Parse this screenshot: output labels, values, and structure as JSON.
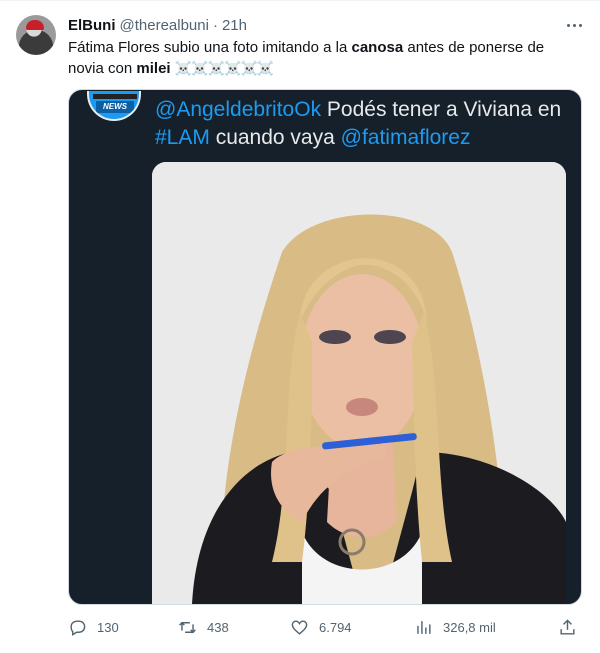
{
  "tweet": {
    "author": {
      "display_name": "ElBuni",
      "handle": "@therealbuni",
      "separator": "·",
      "time": "21h"
    },
    "text": {
      "part1": "Fátima Flores subio una foto imitando a la ",
      "bold1": "canosa",
      "part2": " antes de ponerse de novia con ",
      "bold2": "milei",
      "emoji": "☠️☠️☠️☠️☠️☠️"
    },
    "quoted": {
      "avatar_badge": "NEWS",
      "mention1": "@AngeldebritoOk",
      "text1": " Podés tener a Viviana en ",
      "hashtag": "#LAM",
      "text2": " cuando vaya ",
      "mention2": "@fatimaflorez"
    },
    "stats": {
      "replies": "130",
      "retweets": "438",
      "likes": "6.794",
      "views": "326,8 mil"
    }
  },
  "icons": {
    "more": "more-dots-icon",
    "reply": "reply-icon",
    "retweet": "retweet-icon",
    "like": "heart-icon",
    "views": "views-chart-icon",
    "share": "share-icon"
  },
  "colors": {
    "accent": "#1d9bf0",
    "secondary_text": "#536471",
    "quote_bg": "#15202b"
  }
}
